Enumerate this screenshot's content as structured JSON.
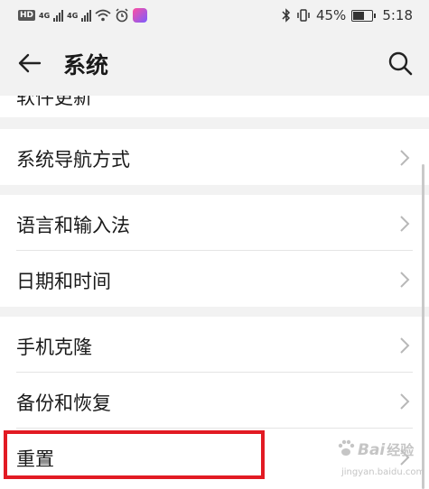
{
  "status_bar": {
    "hd": "HD",
    "net1": "4G",
    "net2": "4G",
    "battery_percent": "45%",
    "time": "5:18",
    "icons": [
      "wifi-icon",
      "alarm-icon",
      "app-notification-icon",
      "bluetooth-icon",
      "vibrate-icon",
      "battery-icon"
    ]
  },
  "header": {
    "title": "系统",
    "back_icon": "arrow-left-icon",
    "search_icon": "search-icon"
  },
  "menu": {
    "partial_item": "软件更新",
    "groups": [
      {
        "items": [
          "系统导航方式"
        ]
      },
      {
        "items": [
          "语言和输入法",
          "日期和时间"
        ]
      },
      {
        "items": [
          "手机克隆",
          "备份和恢复",
          "重置"
        ]
      }
    ],
    "highlighted_item": "重置"
  },
  "watermark": {
    "brand": "Bai",
    "brand_cn": "经验",
    "url": "jingyan.baidu.com"
  },
  "colors": {
    "background": "#f2f2f2",
    "card": "#ffffff",
    "highlight": "#e21a23",
    "arrow": "#b8b8b8"
  }
}
